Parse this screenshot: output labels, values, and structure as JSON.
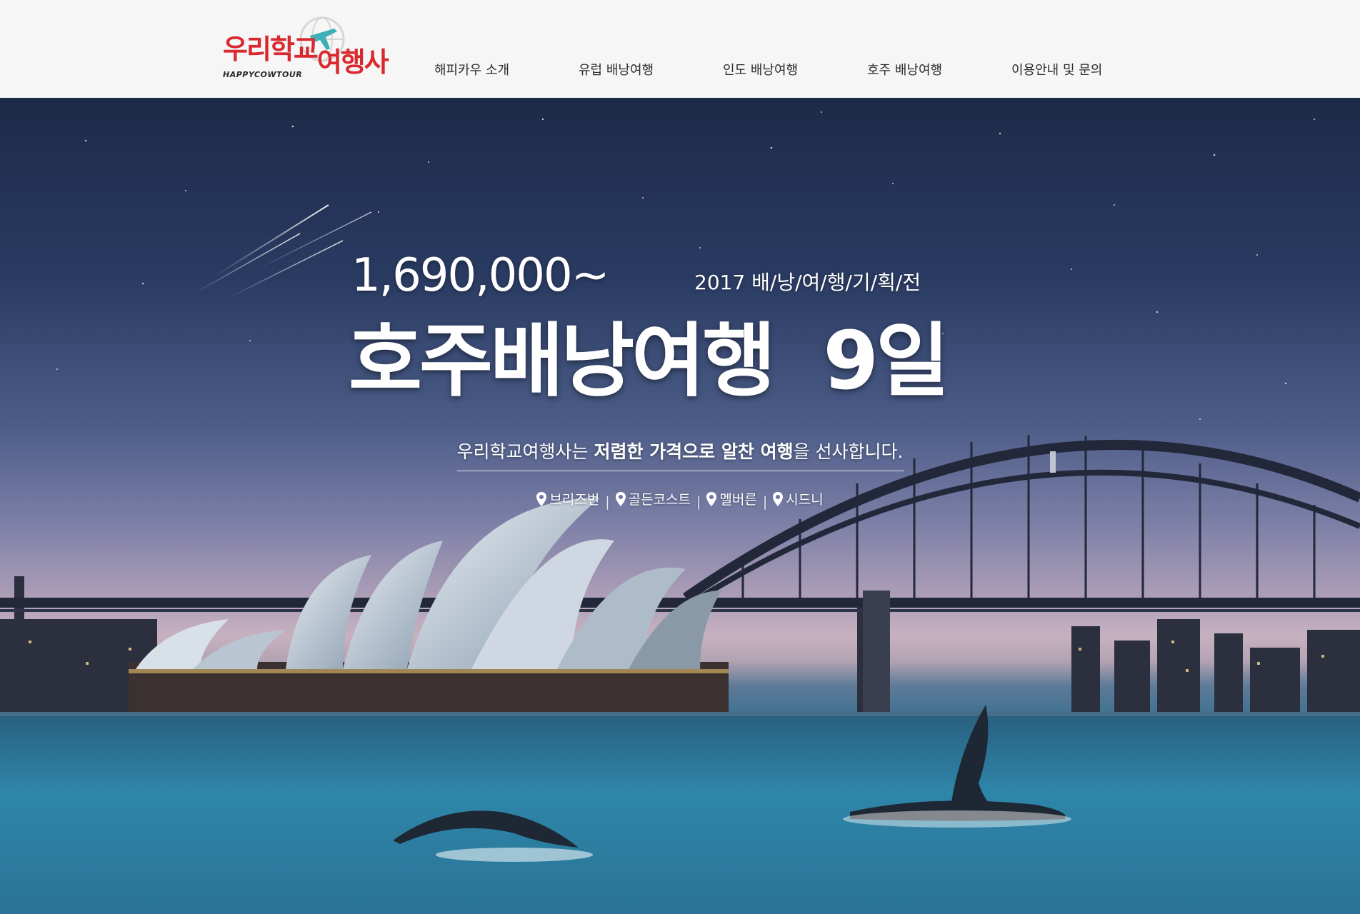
{
  "logo": {
    "line1": "우리학교",
    "line2": "여행사",
    "sub": "HAPPYCOWTOUR",
    "brand_color": "#d9282f",
    "accent_color": "#3fb0b7"
  },
  "nav": {
    "items": [
      {
        "label": "해피카우 소개"
      },
      {
        "label": "유럽 배낭여행"
      },
      {
        "label": "인도 배낭여행"
      },
      {
        "label": "호주 배낭여행"
      },
      {
        "label": "이용안내 및 문의"
      }
    ]
  },
  "hero": {
    "price": "1,690,000~",
    "subtitle": "2017 배/낭/여/행/기/획/전",
    "title": "호주배낭여행  9일",
    "tagline_prefix": "우리학교여행사는 ",
    "tagline_bold1": "저렴한 가격으로 알찬 여행",
    "tagline_suffix": "을 선사합니다.",
    "cities": [
      {
        "name": "브리즈번",
        "icon": "location-pin-icon"
      },
      {
        "name": "골든코스트",
        "icon": "location-pin-icon"
      },
      {
        "name": "멜버른",
        "icon": "location-pin-icon"
      },
      {
        "name": "시드니",
        "icon": "location-pin-icon"
      }
    ],
    "city_separator": "|"
  }
}
